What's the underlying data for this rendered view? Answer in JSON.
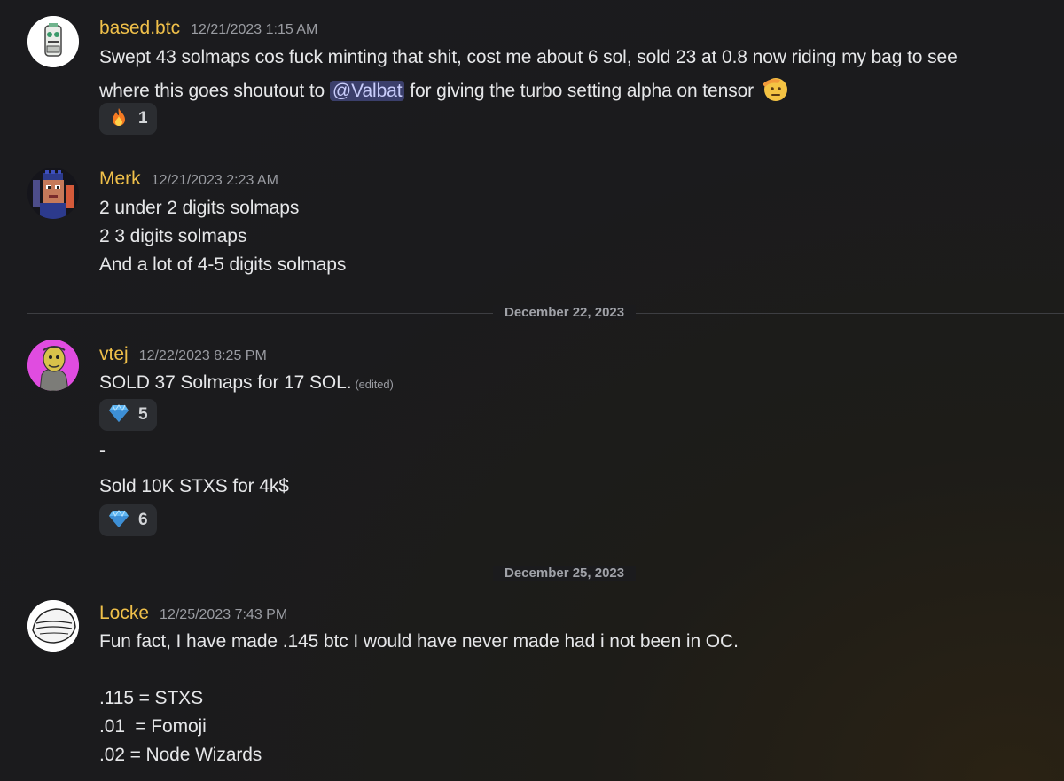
{
  "messages": [
    {
      "username": "based.btc",
      "timestamp": "12/21/2023 1:15 AM",
      "line1": "Swept 43 solmaps cos fuck minting that shit, cost me about 6 sol, sold 23 at 0.8 now riding my bag to see",
      "line2_pre": "where this goes shoutout to ",
      "mention": "@Valbat",
      "line2_post": " for giving the turbo setting alpha on tensor",
      "reaction": {
        "icon": "fire-emoji",
        "count": "1"
      }
    },
    {
      "username": "Merk",
      "timestamp": "12/21/2023 2:23 AM",
      "lines": [
        "2 under 2 digits solmaps",
        "2 3 digits solmaps",
        "And a lot of 4-5 digits solmaps"
      ]
    },
    {
      "username": "vtej",
      "timestamp": "12/22/2023 8:25 PM",
      "line1": "SOLD 37 Solmaps for 17 SOL.",
      "edited": "(edited)",
      "reaction1": {
        "icon": "gem-emoji",
        "count": "5"
      },
      "dash": "-",
      "line2": "Sold 10K STXS for 4k$",
      "reaction2": {
        "icon": "gem-emoji",
        "count": "6"
      }
    },
    {
      "username": "Locke",
      "timestamp": "12/25/2023 7:43 PM",
      "lines": [
        "Fun fact, I have made .145 btc I would have never made had i not been in OC.",
        ".115 = STXS",
        ".01  = Fomoji",
        ".02 = Node Wizards"
      ]
    }
  ],
  "dividers": [
    "December 22, 2023",
    "December 25, 2023"
  ],
  "colors": {
    "username": "#f0c04a",
    "mention_bg": "#3b3f6b",
    "reaction_bg": "#2b2d31"
  }
}
